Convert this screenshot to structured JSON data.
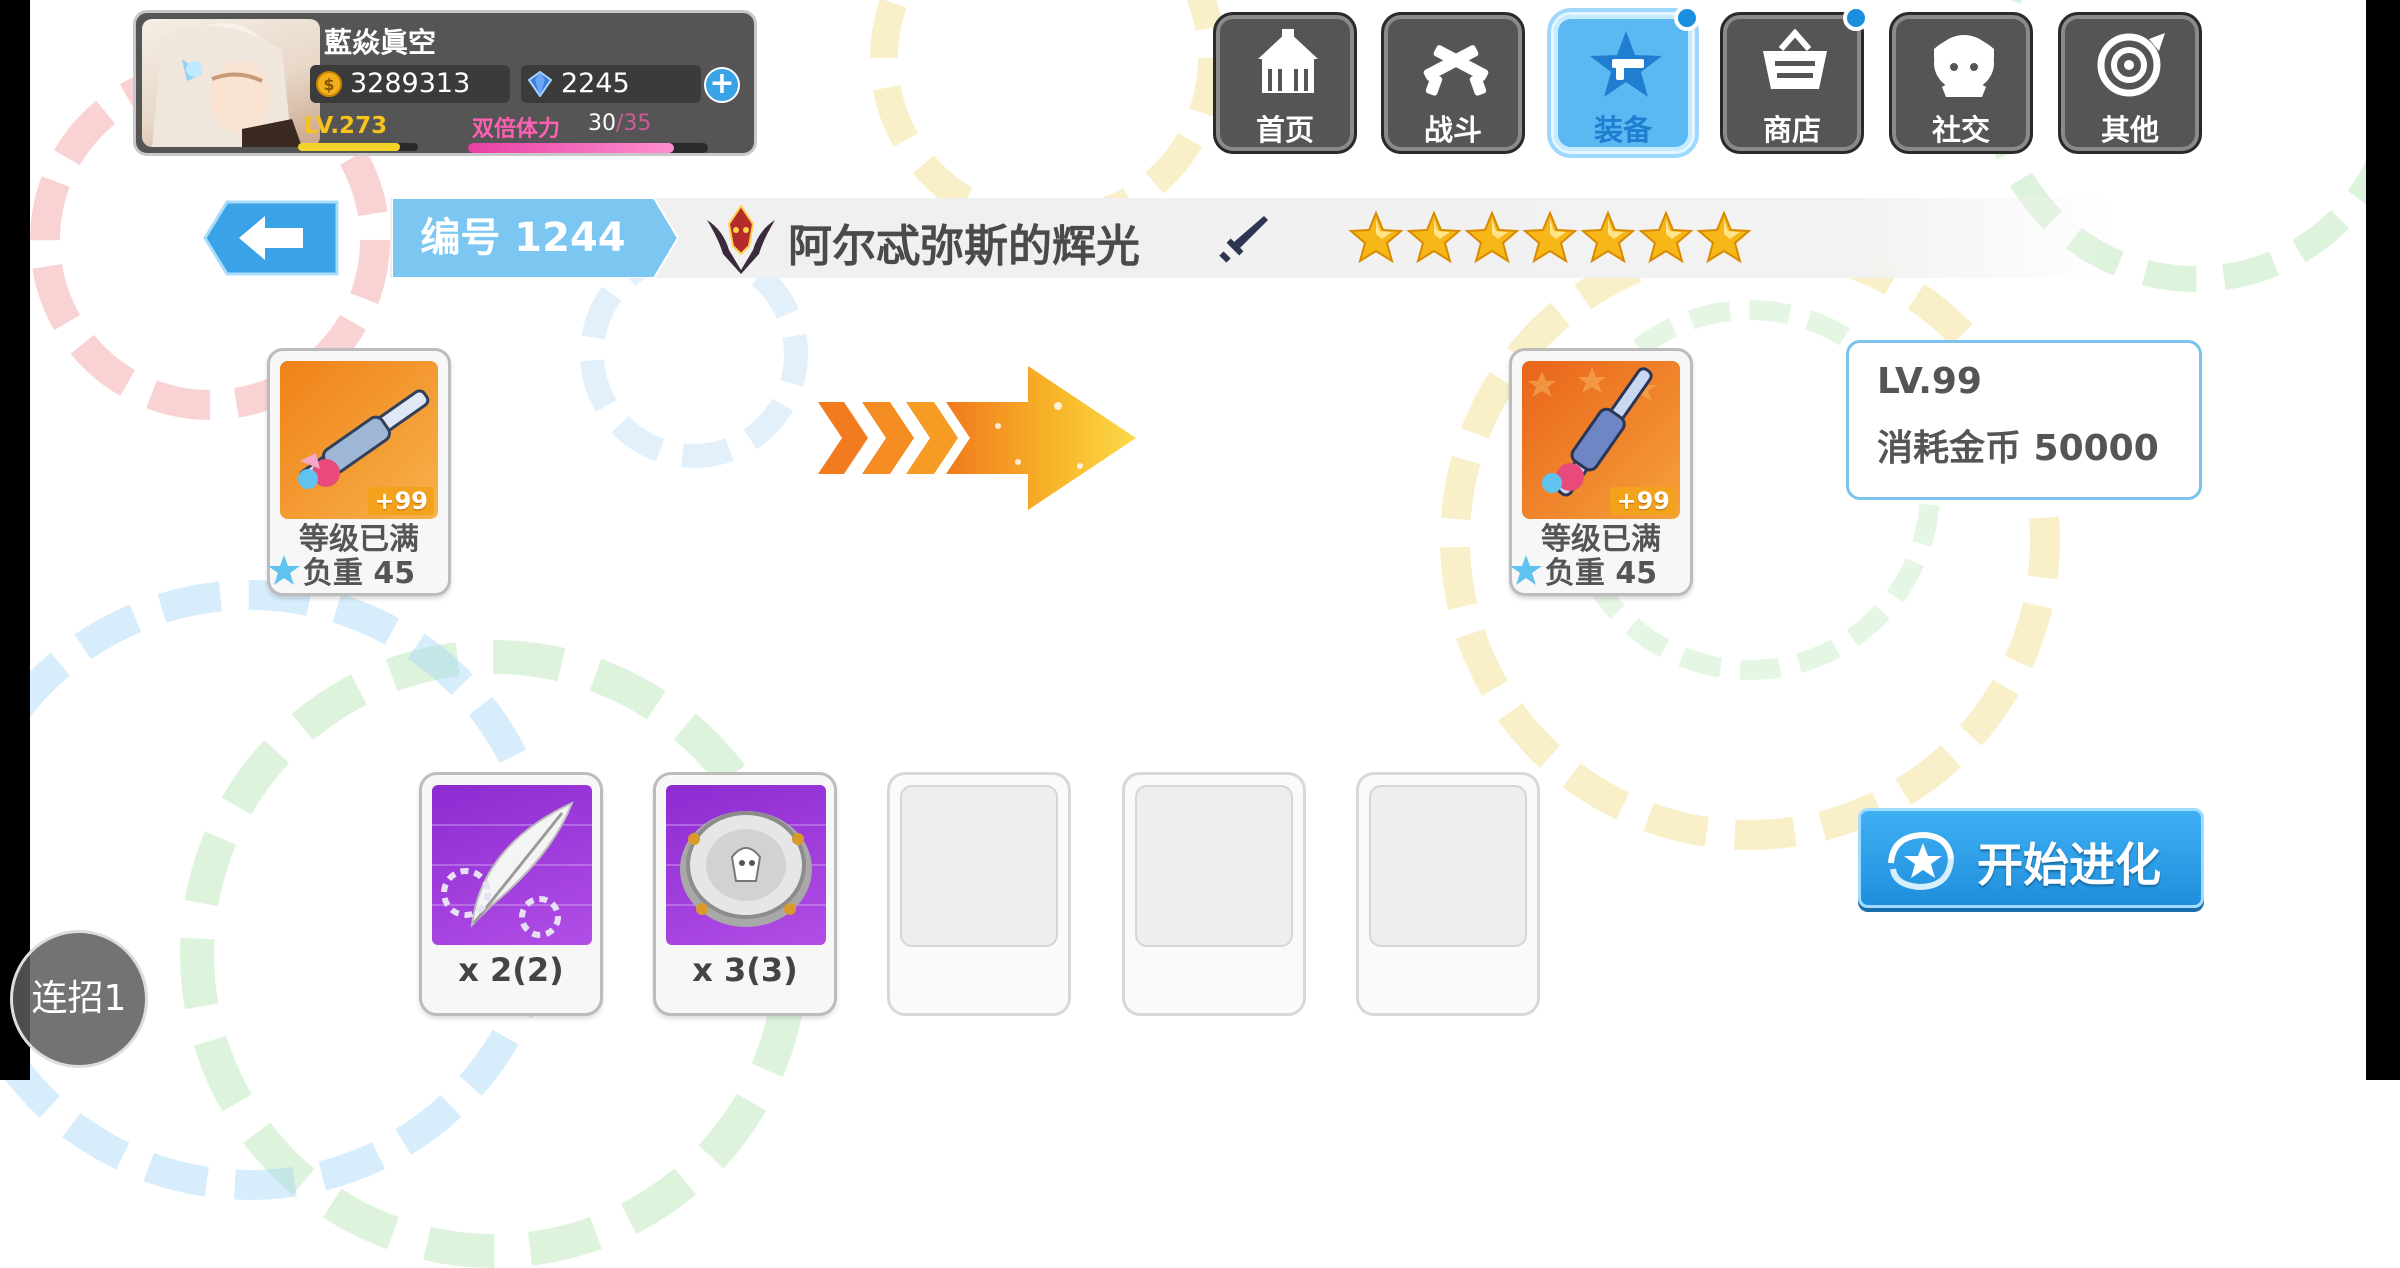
{
  "player": {
    "name": "藍焱眞空",
    "coins": "3289313",
    "gems": "2245",
    "level": "LV.273",
    "level_progress": 0.85,
    "stamina_label": "双倍体力",
    "stamina_current": "30",
    "stamina_max": "/35",
    "stamina_progress": 0.86
  },
  "nav": {
    "items": [
      {
        "label": "首页",
        "icon": "house-icon"
      },
      {
        "label": "战斗",
        "icon": "crossed-guns-icon"
      },
      {
        "label": "装备",
        "icon": "star-gun-icon",
        "active": true,
        "notify": true
      },
      {
        "label": "商店",
        "icon": "basket-icon",
        "notify": true
      },
      {
        "label": "社交",
        "icon": "chibi-face-icon"
      },
      {
        "label": "其他",
        "icon": "target-icon"
      }
    ]
  },
  "header": {
    "id_label": "编号 1244",
    "weapon_name": "阿尔忒弥斯的辉光",
    "weapon_type_icon": "sword-icon",
    "stars": 7
  },
  "source_weapon": {
    "plus": "+99",
    "status": "等级已满",
    "weight": "负重 45"
  },
  "target_weapon": {
    "plus": "+99",
    "status": "等级已满",
    "weight": "负重 45"
  },
  "evolve_info": {
    "level": "LV.99",
    "cost": "消耗金币 50000"
  },
  "materials": [
    {
      "qty": "x 2(2)",
      "icon": "feather-icon"
    },
    {
      "qty": "x 3(3)",
      "icon": "badge-icon"
    },
    {
      "qty": ""
    },
    {
      "qty": ""
    },
    {
      "qty": ""
    }
  ],
  "actions": {
    "start_label": "开始进化",
    "combo_label": "连招1"
  },
  "colors": {
    "accent": "#3aa3e8",
    "star": "#f7b718",
    "stamina": "#ff5fb4",
    "level": "#f7c21b"
  }
}
